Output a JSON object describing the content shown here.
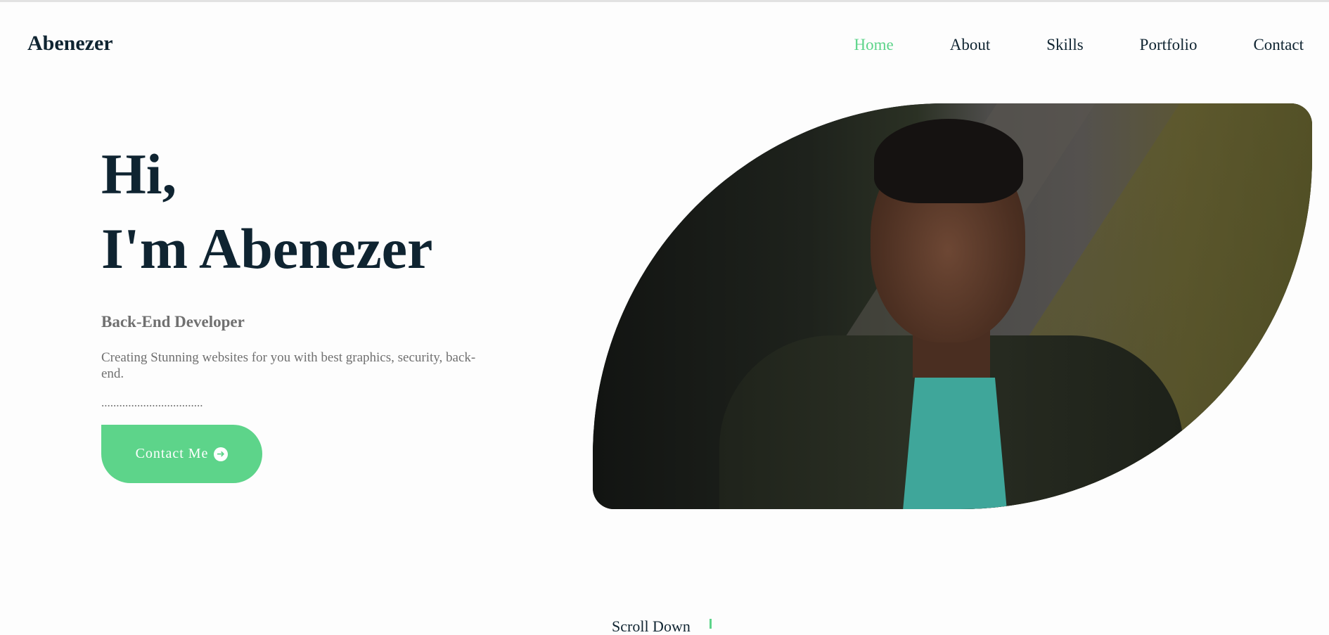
{
  "header": {
    "logo": "Abenezer",
    "nav": [
      {
        "label": "Home",
        "active": true
      },
      {
        "label": "About",
        "active": false
      },
      {
        "label": "Skills",
        "active": false
      },
      {
        "label": "Portfolio",
        "active": false
      },
      {
        "label": "Contact",
        "active": false
      }
    ]
  },
  "hero": {
    "greeting_line1": "Hi,",
    "greeting_line2": "I'm Abenezer",
    "role": "Back-End Developer",
    "description": "Creating Stunning websites for you with best graphics, security, back-end.",
    "dots": "..................................",
    "cta_label": "Contact Me",
    "cta_icon": "arrow-right-circle-icon"
  },
  "scroll": {
    "label": "Scroll Down"
  },
  "colors": {
    "accent": "#5dd48a",
    "text_dark": "#0f2431",
    "text_muted": "#707070"
  }
}
